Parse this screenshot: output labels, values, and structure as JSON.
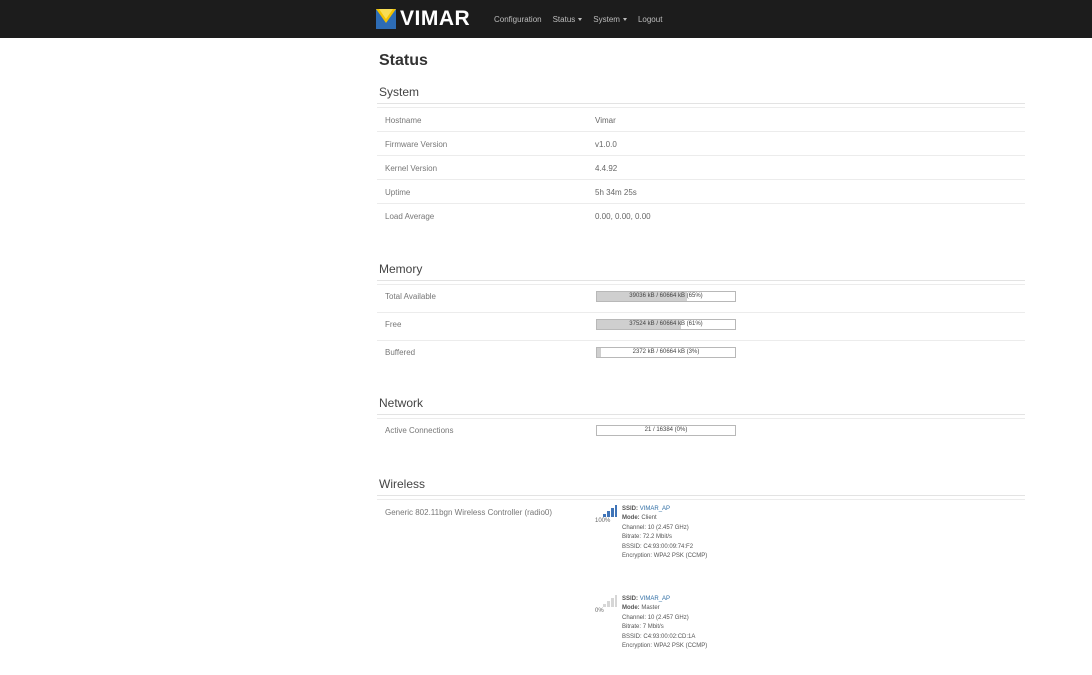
{
  "brand": {
    "name": "VIMAR"
  },
  "nav": [
    {
      "label": "Configuration",
      "dropdown": false
    },
    {
      "label": "Status",
      "dropdown": true
    },
    {
      "label": "System",
      "dropdown": true
    },
    {
      "label": "Logout",
      "dropdown": false
    }
  ],
  "page": {
    "title": "Status"
  },
  "system": {
    "title": "System",
    "rows": [
      {
        "label": "Hostname",
        "value": "Vimar"
      },
      {
        "label": "Firmware Version",
        "value": "v1.0.0"
      },
      {
        "label": "Kernel Version",
        "value": "4.4.92"
      },
      {
        "label": "Uptime",
        "value": "5h 34m 25s"
      },
      {
        "label": "Load Average",
        "value": "0.00, 0.00, 0.00"
      }
    ]
  },
  "memory": {
    "title": "Memory",
    "rows": [
      {
        "label": "Total Available",
        "bar_text": "39036 kB / 60664 kB (65%)",
        "percent": 65
      },
      {
        "label": "Free",
        "bar_text": "37524 kB / 60664 kB (61%)",
        "percent": 61
      },
      {
        "label": "Buffered",
        "bar_text": "2372 kB / 60664 kB (3%)",
        "percent": 3
      }
    ]
  },
  "network": {
    "title": "Network",
    "rows": [
      {
        "label": "Active Connections",
        "bar_text": "21 / 16384 (0%)",
        "percent": 0
      }
    ]
  },
  "wireless": {
    "title": "Wireless",
    "device_label": "Generic 802.11bgn Wireless Controller (radio0)",
    "networks": [
      {
        "signal": "100%",
        "signal_level": 1.0,
        "ssid_key": "SSID:",
        "ssid": "VIMAR_AP",
        "mode_key": "Mode:",
        "mode": "Client",
        "channel_key": "Channel:",
        "channel": "10 (2.457 GHz)",
        "bitrate_key": "Bitrate:",
        "bitrate": "72.2 Mbit/s",
        "bssid_key": "BSSID:",
        "bssid": "C4:93:00:09:74:F2",
        "encryption_key": "Encryption:",
        "encryption": "WPA2 PSK (CCMP)"
      },
      {
        "signal": "0%",
        "signal_level": 0.0,
        "ssid_key": "SSID:",
        "ssid": "VIMAR_AP",
        "mode_key": "Mode:",
        "mode": "Master",
        "channel_key": "Channel:",
        "channel": "10 (2.457 GHz)",
        "bitrate_key": "Bitrate:",
        "bitrate": "7 Mbit/s",
        "bssid_key": "BSSID:",
        "bssid": "C4:93:00:02:CD:1A",
        "encryption_key": "Encryption:",
        "encryption": "WPA2 PSK (CCMP)"
      }
    ]
  },
  "colors": {
    "topbar": "#1c1c1c",
    "logo_yellow": "#f2c200",
    "logo_blue": "#2d6cb5",
    "link": "#2e6da4"
  }
}
